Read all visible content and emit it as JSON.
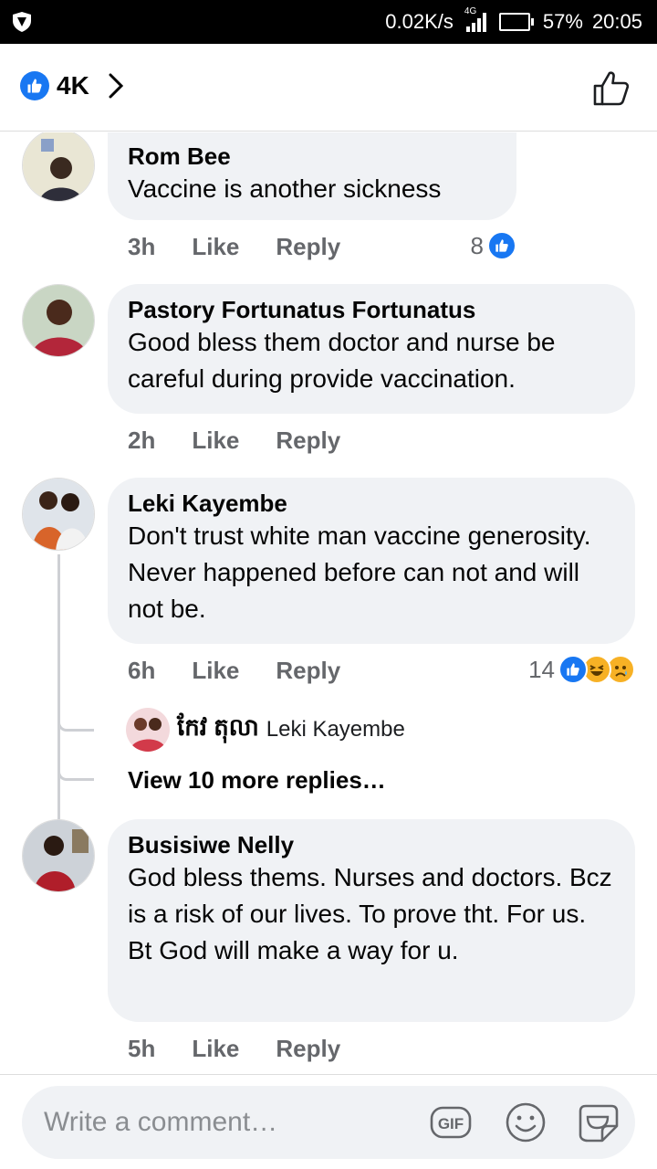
{
  "status_bar": {
    "speed": "0.02K/s",
    "network": "4G",
    "battery": "57%",
    "time": "20:05"
  },
  "header": {
    "reaction_count": "4K"
  },
  "comments": [
    {
      "name": "Rom Bee",
      "text": "Vaccine is another sickness",
      "time": "3h",
      "like": "Like",
      "reply": "Reply",
      "reactions": "8"
    },
    {
      "name": "Pastory Fortunatus Fortunatus",
      "text": "Good bless them doctor and nurse be careful during provide vaccination.",
      "time": "2h",
      "like": "Like",
      "reply": "Reply"
    },
    {
      "name": "Leki Kayembe",
      "text": "Don't trust white man vaccine generosity. Never happened before can not and will not be.",
      "time": "6h",
      "like": "Like",
      "reply": "Reply",
      "reactions": "14",
      "reply_preview": {
        "name": "កែវ តុលា",
        "text": "Leki Kayembe"
      },
      "more_replies": "View 10 more replies…"
    },
    {
      "name": "Busisiwe Nelly",
      "text": "God bless thems. Nurses and doctors.  Bcz is a risk of our lives. To prove tht.  For us. Bt God will make a way for u.",
      "time": "5h",
      "like": "Like",
      "reply": "Reply"
    }
  ],
  "composer": {
    "placeholder": "Write a comment…",
    "gif_label": "GIF"
  },
  "colors": {
    "like_blue": "#1877f2",
    "haha_yellow": "#f7b125",
    "bubble_bg": "#f0f2f5",
    "meta_gray": "#65676b"
  }
}
